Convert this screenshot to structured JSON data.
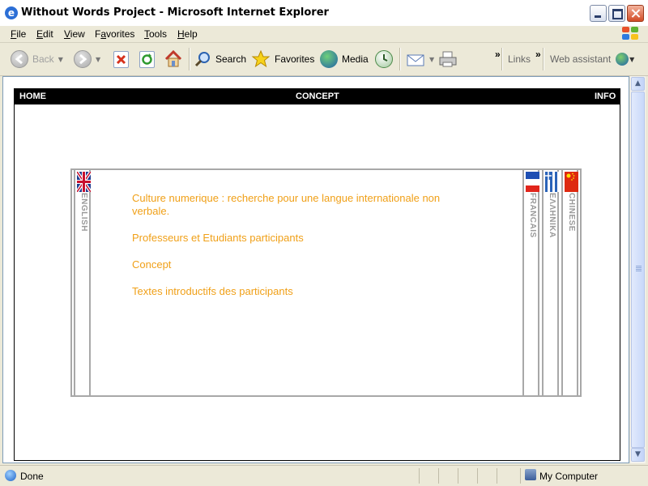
{
  "window": {
    "title": "Without Words Project - Microsoft Internet Explorer"
  },
  "menu": {
    "items": [
      {
        "pre": "",
        "u": "F",
        "post": "ile"
      },
      {
        "pre": "",
        "u": "E",
        "post": "dit"
      },
      {
        "pre": "",
        "u": "V",
        "post": "iew"
      },
      {
        "pre": "F",
        "u": "a",
        "post": "vorites"
      },
      {
        "pre": "",
        "u": "T",
        "post": "ools"
      },
      {
        "pre": "",
        "u": "H",
        "post": "elp"
      }
    ]
  },
  "toolbar": {
    "back": "Back",
    "search": "Search",
    "favorites": "Favorites",
    "media": "Media",
    "chevron": "»",
    "links": "Links",
    "web_assistant": "Web assistant"
  },
  "page": {
    "nav": {
      "home": "HOME",
      "concept": "CONCEPT",
      "info": "INFO"
    },
    "languages": {
      "english": "ENGLISH",
      "francais": "FRANCAIS",
      "greek": "ΕΛΛΗΝΙΚΑ",
      "chinese": "CHINESE"
    },
    "links": {
      "culture": "Culture numerique : recherche pour une langue internationale non verbale.",
      "profs": "Professeurs et Etudiants participants",
      "concept": "Concept",
      "textes": "Textes introductifs des participants"
    }
  },
  "status": {
    "text": "Done",
    "zone": "My Computer"
  },
  "colors": {
    "link": "#f0a018",
    "nav_bg": "#000000",
    "border_gray": "#a8a8a8"
  }
}
